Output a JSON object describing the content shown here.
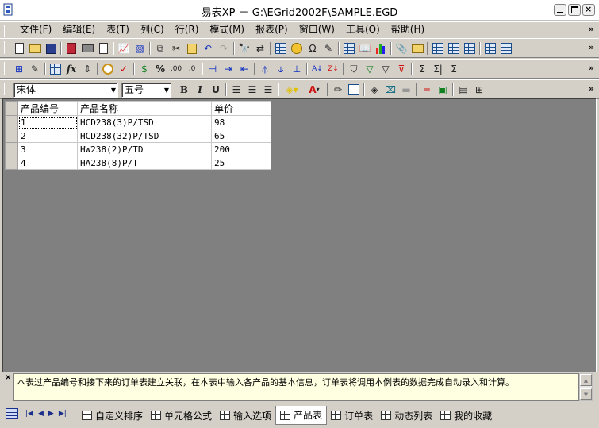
{
  "window": {
    "title": "易表XP － G:\\EGrid2002F\\SAMPLE.EGD"
  },
  "menu": [
    "文件(F)",
    "编辑(E)",
    "表(T)",
    "列(C)",
    "行(R)",
    "模式(M)",
    "报表(P)",
    "窗口(W)",
    "工具(O)",
    "帮助(H)"
  ],
  "font_bar": {
    "family": "宋体",
    "size": "五号"
  },
  "toolbar_icons": {
    "row1": [
      "new-doc-icon",
      "open-folder-icon",
      "save-icon",
      "book-icon",
      "print-icon",
      "print-preview-icon",
      "chart-icon",
      "fill-icon",
      "copy-icon",
      "cut-icon",
      "paste-icon",
      "undo-icon",
      "redo-icon",
      "find-icon",
      "replace-icon",
      "calendar-icon",
      "clock-icon",
      "omega-icon",
      "filter-icon",
      "form-icon",
      "report-icon",
      "bar-chart-icon",
      "attach-icon",
      "export-icon",
      "view1-icon",
      "view2-icon",
      "view3-icon",
      "window1-icon",
      "window2-icon"
    ],
    "row2": [
      "insert-row-icon",
      "edit-icon",
      "grid-icon",
      "function-icon",
      "formula-icon",
      "timer-icon",
      "check-icon",
      "money-icon",
      "percent-icon",
      "increase-decimal-icon",
      "decrease-decimal-icon",
      "insert-col-icon",
      "move-right-icon",
      "move-left-icon",
      "split-icon",
      "merge-icon",
      "sort-asc-icon",
      "sort-desc-icon",
      "filter-icon",
      "filter-add-icon",
      "filter-remove-icon",
      "filter-clear-icon",
      "sum-icon",
      "subtotal-icon",
      "sigma-icon"
    ]
  },
  "sheet": {
    "headers": [
      "产品编号",
      "产品名称",
      "单价"
    ],
    "rows": [
      [
        "1",
        "HCD238(3)P/TSD",
        "98"
      ],
      [
        "2",
        "HCD238(32)P/TSD",
        "65"
      ],
      [
        "3",
        "HW238(2)P/TD",
        "200"
      ],
      [
        "4",
        "HA238(8)P/T",
        "25"
      ]
    ]
  },
  "notes": {
    "text": "本表过产品编号和接下来的订单表建立关联，在本表中输入各产品的基本信息，订单表将调用本例表的数据完成自动录入和计算。"
  },
  "tabs": [
    "自定义排序",
    "单元格公式",
    "输入选项",
    "产品表",
    "订单表",
    "动态列表",
    "我的收藏"
  ],
  "active_tab": "产品表",
  "colors": {
    "grid_bg": "#808080",
    "chrome": "#d4d0c8",
    "note_bg": "#ffffe1"
  }
}
